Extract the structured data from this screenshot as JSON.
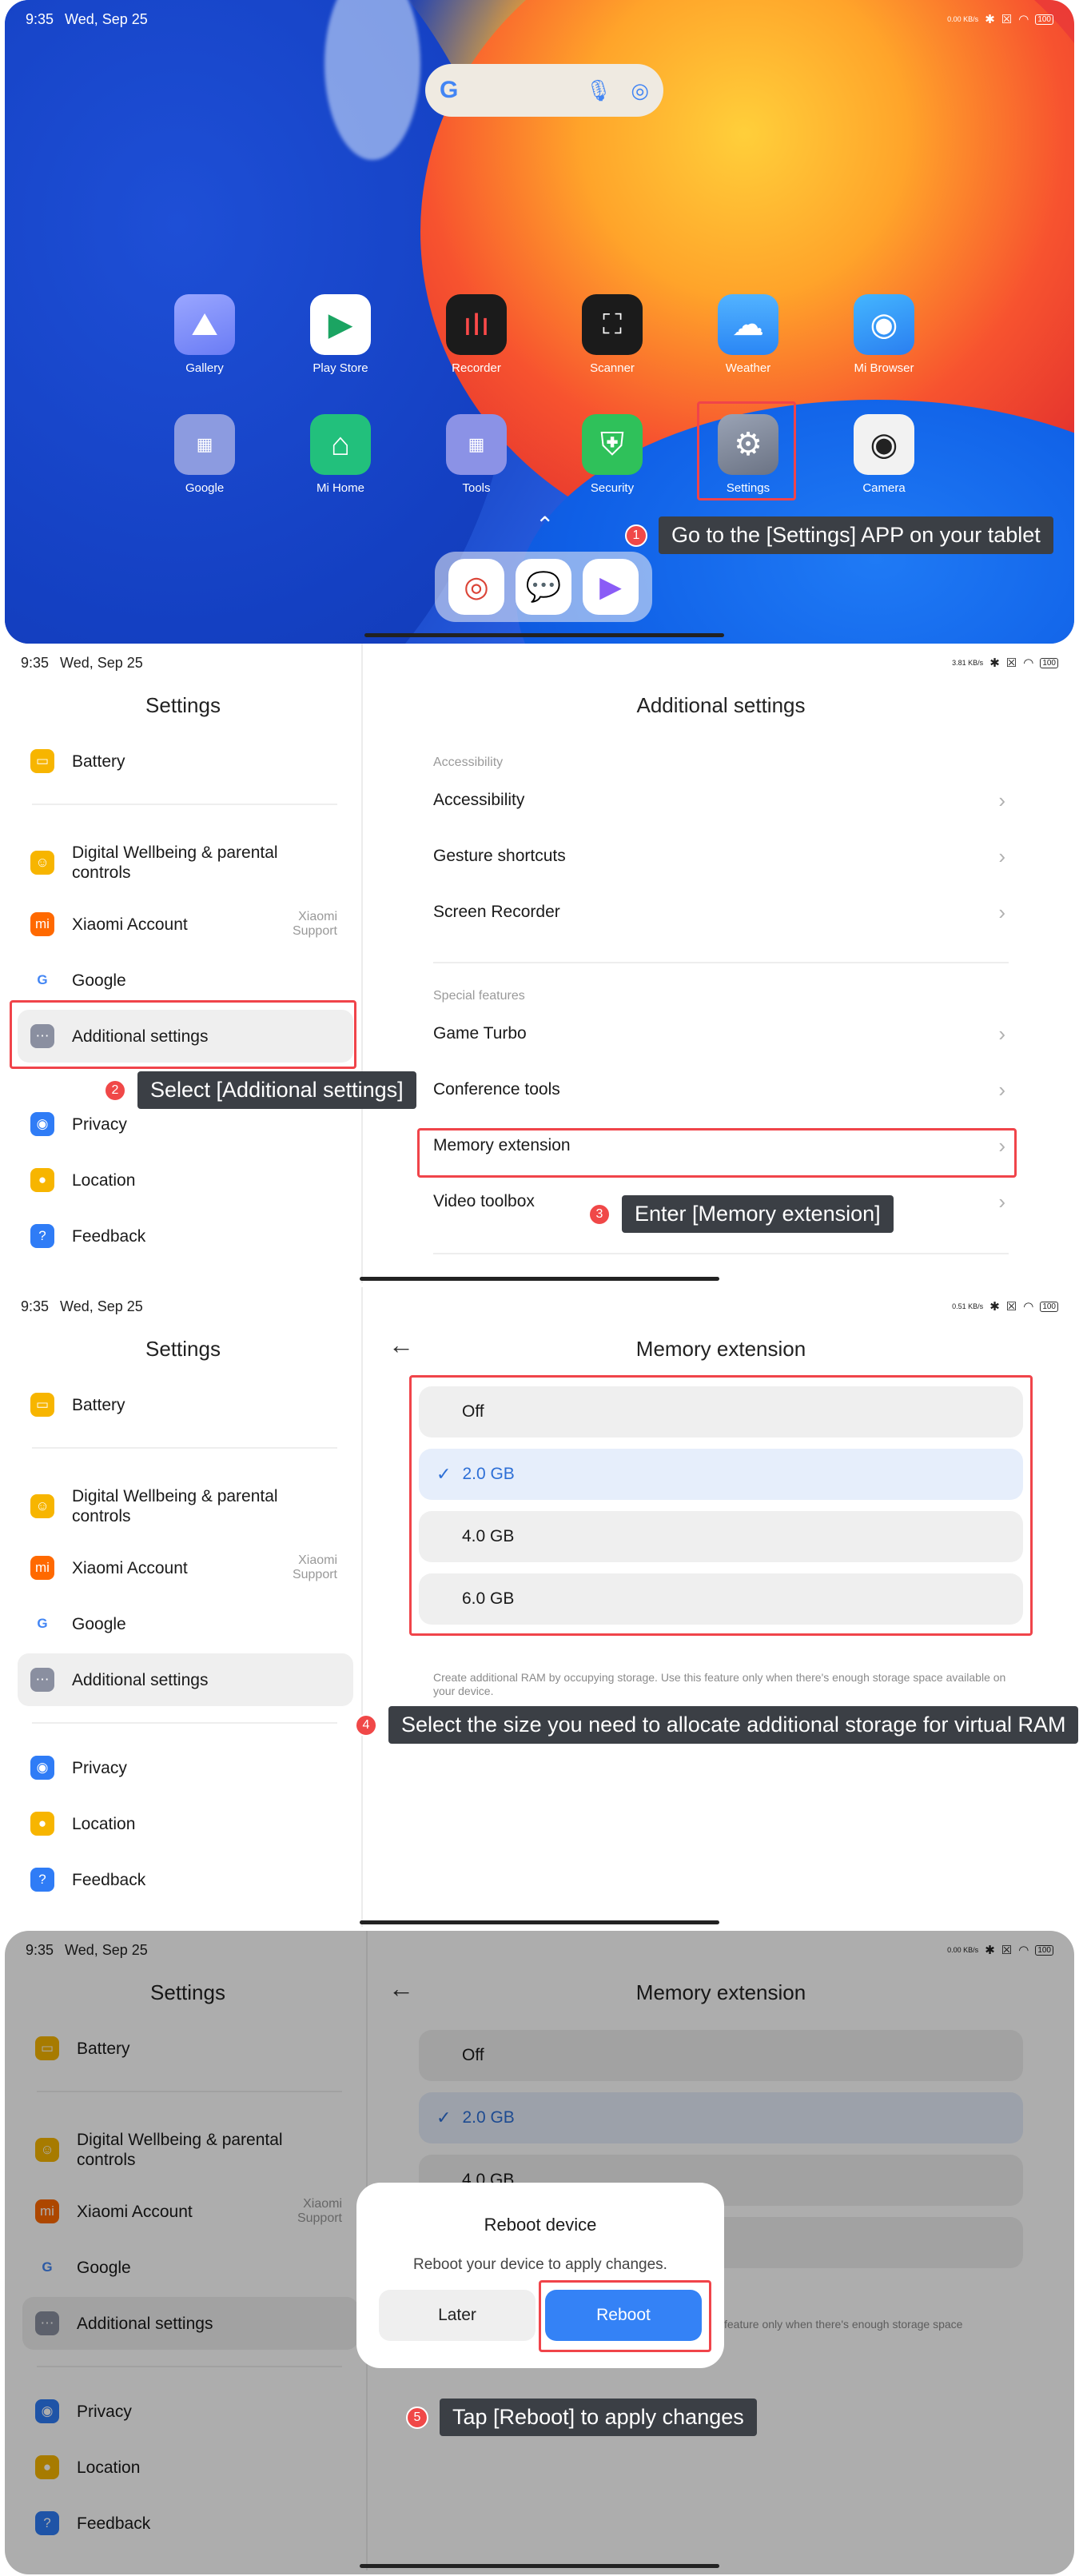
{
  "status": {
    "time": "9:35",
    "date": "Wed, Sep 25",
    "p1_speed": "0.00 KB/s",
    "p2_speed": "3.81 KB/s",
    "p3_speed": "0.51 KB/s",
    "p4_speed": "0.00 KB/s",
    "battery": "100"
  },
  "home": {
    "apps_row1": [
      "Gallery",
      "Play Store",
      "Recorder",
      "Scanner",
      "Weather",
      "Mi Browser"
    ],
    "apps_row2": [
      "Google",
      "Mi Home",
      "Tools",
      "Security",
      "Settings",
      "Camera"
    ]
  },
  "steps": {
    "s1_num": "1",
    "s1": "Go to the [Settings] APP on your tablet",
    "s2_num": "2",
    "s2": "Select [Additional settings]",
    "s3_num": "3",
    "s3": "Enter [Memory extension]",
    "s4_num": "4",
    "s4": "Select the size you need to allocate additional storage for virtual RAM",
    "s5_num": "5",
    "s5": "Tap [Reboot] to apply changes"
  },
  "sidebar": {
    "title": "Settings",
    "battery": "Battery",
    "wellbeing": "Digital Wellbeing & parental controls",
    "xiaomi_account": "Xiaomi Account",
    "xiaomi_sub": "Xiaomi Support",
    "google": "Google",
    "additional": "Additional settings",
    "privacy": "Privacy",
    "location": "Location",
    "feedback": "Feedback"
  },
  "additional": {
    "title": "Additional settings",
    "accessibility_header": "Accessibility",
    "accessibility": "Accessibility",
    "gesture": "Gesture shortcuts",
    "recorder": "Screen Recorder",
    "special_header": "Special features",
    "game_turbo": "Game Turbo",
    "conference": "Conference tools",
    "memory": "Memory extension",
    "video": "Video toolbox"
  },
  "memory": {
    "title": "Memory extension",
    "options": [
      "Off",
      "2.0 GB",
      "4.0 GB",
      "6.0 GB"
    ],
    "selected": "2.0 GB",
    "note": "Create additional RAM by occupying storage. Use this feature only when there's enough storage space available on your device."
  },
  "dialog": {
    "title": "Reboot device",
    "message": "Reboot your device to apply changes.",
    "later": "Later",
    "reboot": "Reboot",
    "partial_opt": "4.0 GB",
    "partial_note": "feature only when there's enough storage space"
  }
}
